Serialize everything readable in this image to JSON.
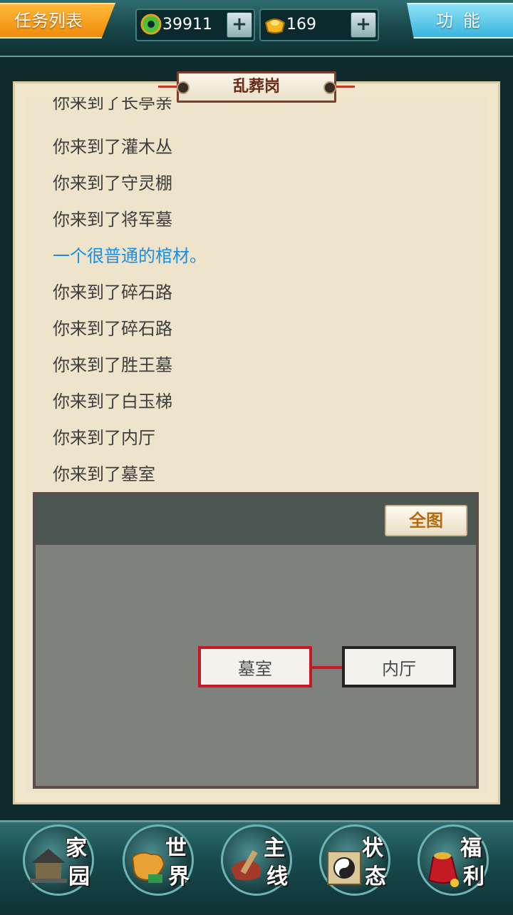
{
  "topbar": {
    "task_list_label": "任务列表",
    "function_label": "功能",
    "jade_amount": "39911",
    "gold_amount": "169",
    "plus_label": "+"
  },
  "location": {
    "title": "乱葬岗"
  },
  "log": {
    "lines": [
      {
        "text": "你来到了长亭亲",
        "highlight": false
      },
      {
        "text": "你来到了灌木丛",
        "highlight": false
      },
      {
        "text": "你来到了守灵棚",
        "highlight": false
      },
      {
        "text": "你来到了将军墓",
        "highlight": false
      },
      {
        "text": "一个很普通的棺材。",
        "highlight": true
      },
      {
        "text": "你来到了碎石路",
        "highlight": false
      },
      {
        "text": "你来到了碎石路",
        "highlight": false
      },
      {
        "text": "你来到了胜王墓",
        "highlight": false
      },
      {
        "text": "你来到了白玉梯",
        "highlight": false
      },
      {
        "text": "你来到了内厅",
        "highlight": false
      },
      {
        "text": "你来到了墓室",
        "highlight": false
      }
    ]
  },
  "map": {
    "full_map_label": "全图",
    "current_room": "墓室",
    "adjacent_room": "内厅"
  },
  "bottom_nav": {
    "items": [
      {
        "l1": "家",
        "l2": "园"
      },
      {
        "l1": "世",
        "l2": "界"
      },
      {
        "l1": "主",
        "l2": "线"
      },
      {
        "l1": "状",
        "l2": "态"
      },
      {
        "l1": "福",
        "l2": "利"
      }
    ]
  },
  "colors": {
    "highlight_text": "#1a8de4",
    "current_room_border": "#c41a26"
  }
}
